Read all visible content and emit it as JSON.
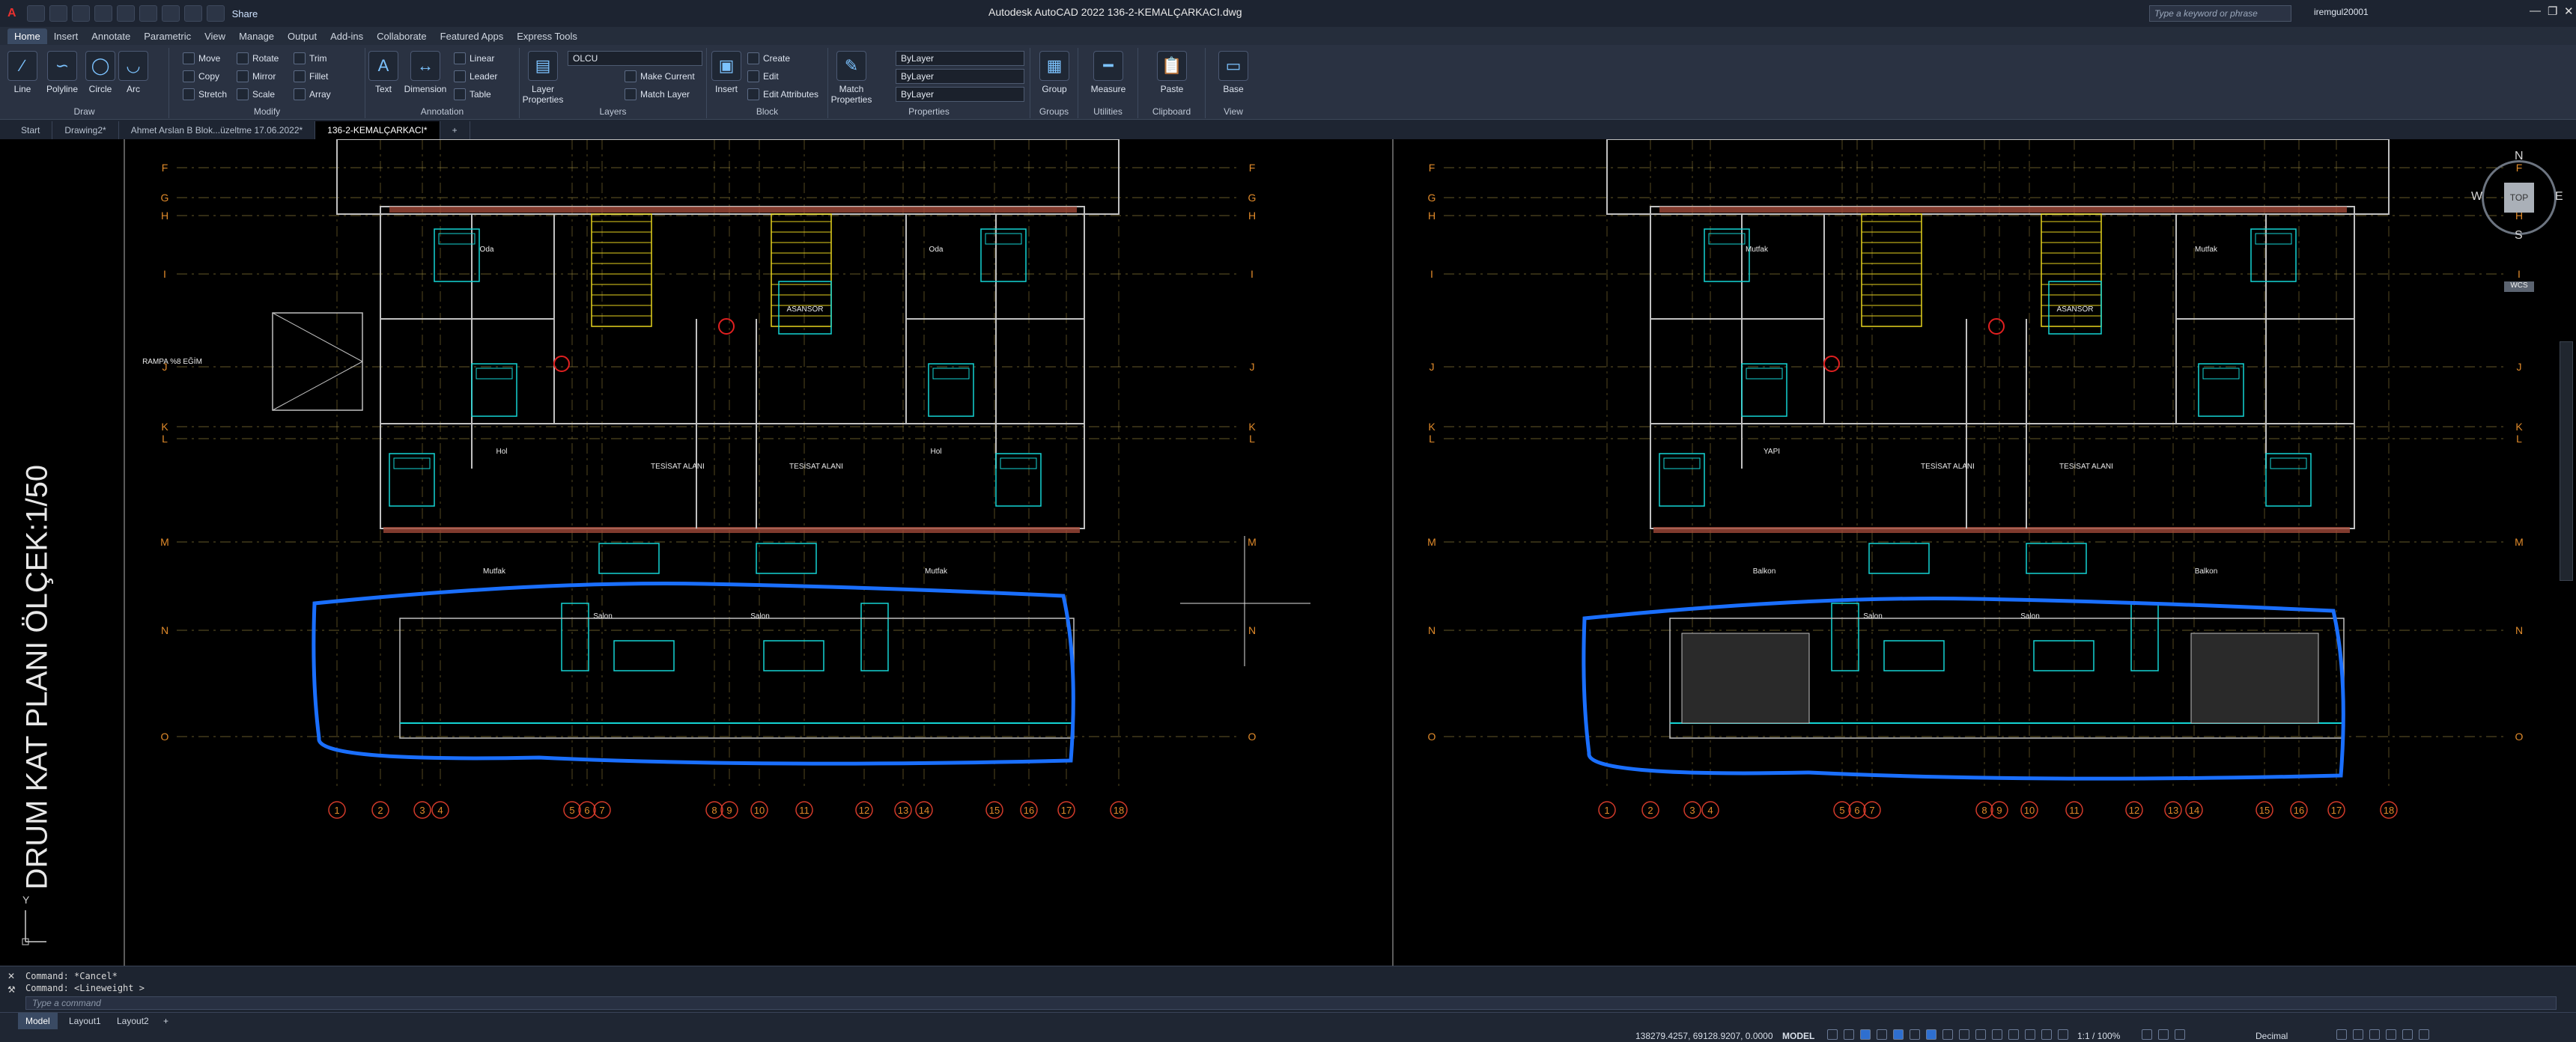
{
  "titlebar": {
    "logo": "A",
    "share": "Share",
    "title": "Autodesk AutoCAD 2022   136-2-KEMALÇARKACI.dwg",
    "search_placeholder": "Type a keyword or phrase",
    "user": "iremgul20001"
  },
  "menu": [
    "Home",
    "Insert",
    "Annotate",
    "Parametric",
    "View",
    "Manage",
    "Output",
    "Add-ins",
    "Collaborate",
    "Featured Apps",
    "Express Tools"
  ],
  "ribbon": {
    "draw": {
      "title": "Draw",
      "line": "Line",
      "polyline": "Polyline",
      "circle": "Circle",
      "arc": "Arc"
    },
    "modify": {
      "title": "Modify",
      "move": "Move",
      "rotate": "Rotate",
      "trim": "Trim",
      "copy": "Copy",
      "mirror": "Mirror",
      "fillet": "Fillet",
      "stretch": "Stretch",
      "scale": "Scale",
      "array": "Array"
    },
    "annotation": {
      "title": "Annotation",
      "text": "Text",
      "dimension": "Dimension",
      "linear": "Linear",
      "leader": "Leader",
      "table": "Table"
    },
    "layers": {
      "title": "Layers",
      "layer_properties": "Layer Properties",
      "current_layer": "OLCU",
      "make_current": "Make Current",
      "match_layer": "Match Layer"
    },
    "block": {
      "title": "Block",
      "insert": "Insert",
      "create": "Create",
      "edit": "Edit",
      "edit_attributes": "Edit Attributes"
    },
    "properties": {
      "title": "Properties",
      "match_properties": "Match Properties",
      "color": "ByLayer",
      "linetype": "ByLayer",
      "lineweight": "ByLayer"
    },
    "groups": {
      "title": "Groups",
      "group": "Group"
    },
    "utilities": {
      "title": "Utilities",
      "measure": "Measure"
    },
    "clipboard": {
      "title": "Clipboard",
      "paste": "Paste"
    },
    "view": {
      "title": "View",
      "base": "Base"
    }
  },
  "doc_tabs": [
    "Start",
    "Drawing2*",
    "Ahmet Arslan B Blok...üzeltme 17.06.2022*",
    "136-2-KEMALÇARKACI*"
  ],
  "drawing": {
    "vertical_title": "DRUM KAT PLANI ÖLÇEK:1/50",
    "row_labels": [
      "F",
      "G",
      "H",
      "I",
      "J",
      "K",
      "L",
      "M",
      "N",
      "O"
    ],
    "column_labels": [
      "1",
      "2",
      "3",
      "4",
      "5",
      "6",
      "7",
      "8",
      "9",
      "10",
      "11",
      "12",
      "13",
      "14",
      "15",
      "16",
      "17",
      "18"
    ],
    "room_left": [
      "ASANSÖR",
      "TESİSAT ALANI",
      "TESİSAT ALANI",
      "Salon",
      "Salon",
      "Mutfak",
      "Mutfak",
      "Oda",
      "Oda",
      "Hol",
      "Hol",
      "RAMPA %8 EĞİM"
    ],
    "room_right": [
      "ASANSÖR",
      "TESİSAT ALANI",
      "TESİSAT ALANI",
      "Salon",
      "Salon",
      "Balkon",
      "Balkon",
      "Mutfak",
      "Mutfak",
      "YAPI"
    ],
    "viewcube": {
      "n": "N",
      "s": "S",
      "e": "E",
      "w": "W",
      "top": "TOP",
      "wcs": "WCS"
    },
    "ucs": {
      "y": "Y"
    }
  },
  "command": {
    "history": [
      "Command: *Cancel*",
      "Command:  <Lineweight >"
    ],
    "placeholder": "Type a command"
  },
  "status": {
    "layouts": [
      "Model",
      "Layout1",
      "Layout2"
    ],
    "coords": "138279.4257, 69128.9207, 0.0000",
    "model": "MODEL",
    "scale": "1:1 / 100%",
    "units": "Decimal"
  },
  "colors": {
    "accent": "#3a8fff",
    "grid": "#b8a24a",
    "wall": "#c0c0c0",
    "cyan": "#14d4d4",
    "yellow": "#e6d21e",
    "red": "#e02020",
    "markup": "#1a6fff",
    "hatch": "#a04a3a"
  }
}
